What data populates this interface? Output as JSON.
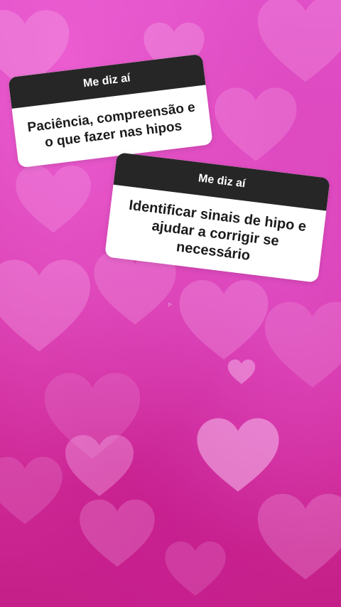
{
  "background": {
    "description_color": "#d52fa3",
    "pattern": "bokeh-hearts"
  },
  "stickers": [
    {
      "header": "Me diz aí",
      "response": "Paciência, compreensão e o que fazer nas hipos"
    },
    {
      "header": "Me diz aí",
      "response": "Identificar sinais de hipo e ajudar a corrigir se necessário"
    }
  ],
  "colors": {
    "card_header_bg": "#262626",
    "card_header_text": "#ffffff",
    "card_body_bg": "#ffffff",
    "card_body_text": "#1b1b1b"
  },
  "icons": {
    "cursor": "pointer-arrow-icon",
    "heart": "heart-icon"
  }
}
